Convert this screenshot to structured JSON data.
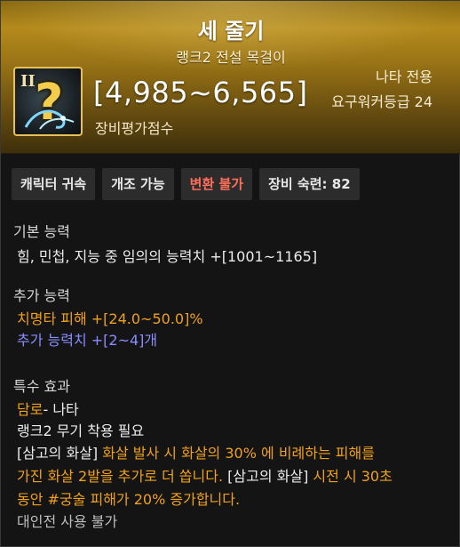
{
  "item": {
    "name": "세 줄기",
    "subtitle": "랭크2 전설 목걸이",
    "rank_badge": "II",
    "score_range": "[4,985~6,565]",
    "score_label": "장비평가점수",
    "class_restriction": "나타 전용",
    "required_level": "요구워커등급 24",
    "icon": "question-mark-necklace-icon"
  },
  "tags": [
    {
      "label": "캐릭터 귀속"
    },
    {
      "label": "개조 가능"
    },
    {
      "label": "변환 불가"
    },
    {
      "label": "장비 숙련: 82"
    }
  ],
  "basic": {
    "title": "기본 능력",
    "line": "힘, 민첩, 지능 중 임의의 능력치 +[1001~1165]"
  },
  "additional": {
    "title": "추가 능력",
    "crit_label": "치명타 피해",
    "crit_value": " +[24.0~50.0]%",
    "stat_label": "추가 능력치 +[2~4]개"
  },
  "special": {
    "title": "특수 효과",
    "damro": "담로",
    "damro_suffix": "- 나타",
    "rank_req": "랭크2 무기 착용 필요",
    "skill_tag": "[삼고의 화살]",
    "skill_desc_1": " 화살 발사 시 화살의 30% 에 비례하는 피해를",
    "skill_desc_2": "가진 화살 2발을 추가로 더 쏩니다.",
    "skill_tag2": " [삼고의 화살]",
    "skill_desc_3": " 시전 시 30초",
    "skill_desc_4": "동안",
    "skill_desc_5": " #궁술 피해가 20% 증가합니다.",
    "pvp": "대인전 사용 불가"
  },
  "colors": {
    "gold_header": "#b48a1c",
    "orange": "#f0a11c",
    "violet": "#8a8cff",
    "red": "#ff6e5a"
  }
}
